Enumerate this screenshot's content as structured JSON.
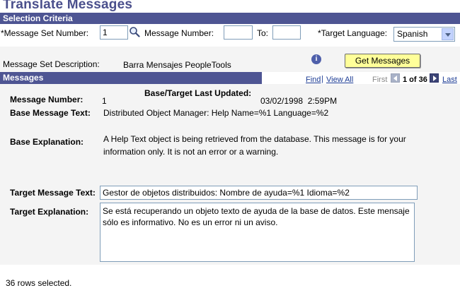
{
  "page": {
    "title": "Translate Messages"
  },
  "criteria": {
    "header": "Selection Criteria",
    "message_set_number_label": "*Message Set Number:",
    "message_set_number_value": "1",
    "message_number_label": "Message Number:",
    "message_number_value": "",
    "to_label": "To:",
    "to_value": "",
    "target_language_label": "*Target Language:",
    "target_language_value": "Spanish",
    "message_set_description_label": "Message Set Description:",
    "message_set_description_value": "Barra Mensajes PeopleTools",
    "get_messages_label": "Get Messages"
  },
  "messages": {
    "header": "Messages",
    "find_label": "Find",
    "view_all_label": "View All",
    "first_label": "First",
    "position_label": "1 of 36",
    "last_label": "Last",
    "message_number_label": "Message Number:",
    "message_number_value": "1",
    "updated_label": "Base/Target Last Updated:",
    "updated_value": "03/02/1998  2:59PM",
    "base_text_label": "Base Message Text:",
    "base_text_value": "Distributed Object Manager: Help Name=%1 Language=%2",
    "base_explanation_label": "Base Explanation:",
    "base_explanation_value": "A Help Text object is being retrieved from the database. This message is for your information only. It is not an error or a warning.",
    "target_text_label": "Target Message Text:",
    "target_text_value": "Gestor de objetos distribuidos: Nombre de ayuda=%1 Idioma=%2",
    "target_explanation_label": "Target Explanation:",
    "target_explanation_value": "Se está recuperando un objeto texto de ayuda de la base de datos. Este mensaje sólo es informativo. No es un error ni un aviso."
  },
  "footer": {
    "status": "36 rows selected."
  }
}
